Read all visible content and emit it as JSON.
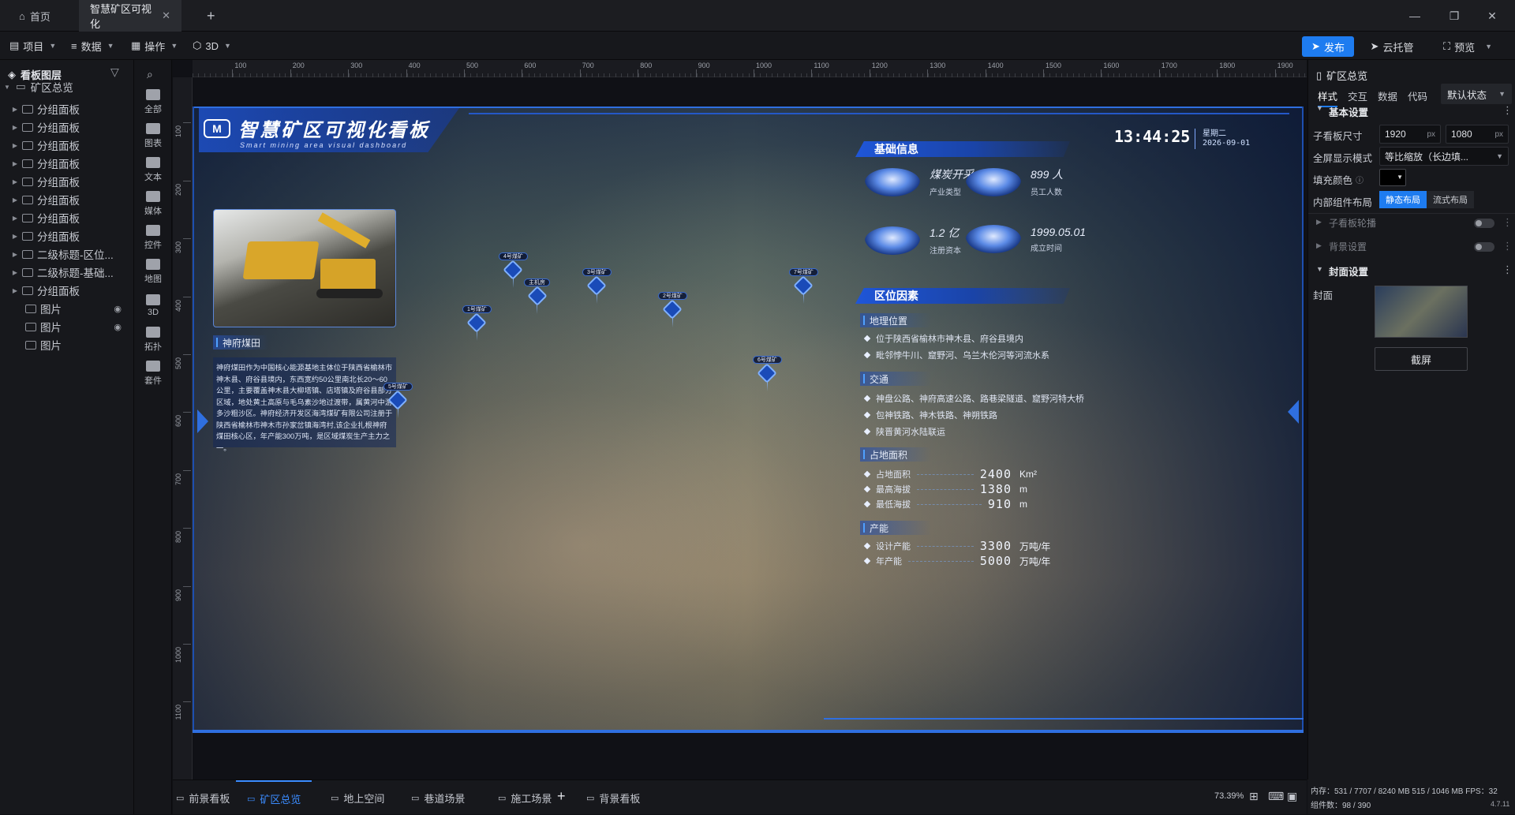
{
  "tabs": {
    "home": "首页",
    "doc": "智慧矿区可视化",
    "new": "+"
  },
  "window": {
    "minimize": "—",
    "restore": "❐",
    "close": "✕"
  },
  "menu": {
    "project": "项目",
    "data": "数据",
    "operate": "操作",
    "threed": "3D"
  },
  "actions": {
    "publish": "发布",
    "cloud": "云托管",
    "preview": "预览"
  },
  "layers": {
    "title": "看板图层",
    "root": "矿区总览",
    "items": [
      "分组面板",
      "分组面板",
      "分组面板",
      "分组面板",
      "分组面板",
      "分组面板",
      "分组面板",
      "分组面板",
      "二级标题-区位...",
      "二级标题-基础...",
      "分组面板",
      "图片",
      "图片",
      "图片"
    ]
  },
  "tools": [
    "全部",
    "图表",
    "文本",
    "媒体",
    "控件",
    "地图",
    "3D",
    "拓扑",
    "套件"
  ],
  "ruler": {
    "h": [
      "100",
      "200",
      "300",
      "400",
      "500",
      "600",
      "700",
      "800",
      "900",
      "1000",
      "1100",
      "1200",
      "1300",
      "1400",
      "1500",
      "1600",
      "1700",
      "1800",
      "1900"
    ],
    "v": [
      "100",
      "200",
      "300",
      "400",
      "500",
      "600",
      "700",
      "800",
      "900",
      "1000",
      "1100"
    ]
  },
  "dashboard": {
    "title": "智慧矿区可视化看板",
    "subtitle": "Smart mining area visual dashboard",
    "logo": "M",
    "time": "13:44:25",
    "weekday": "星期二",
    "date": "2026-09-01",
    "photo_caption": "神府煤田",
    "description": "神府煤田作为中国核心能源基地主体位于陕西省榆林市神木县、府谷县境内，东西宽约50公里南北长20～60公里，主要覆盖神木县大柳塔镇、店塔镇及府谷县部分区域，地处黄土高原与毛乌素沙地过渡带，属黄河中游多沙粗沙区。神府经济开发区海湾煤矿有限公司注册于陕西省榆林市神木市孙家岔镇海湾村,该企业扎根神府煤田核心区，年产能300万吨，是区域煤炭生产主力之一。",
    "basic_info_title": "基础信息",
    "basic_info": [
      {
        "value": "煤炭开采",
        "label": "产业类型"
      },
      {
        "value": "899 人",
        "label": "员工人数"
      },
      {
        "value": "1.2 亿",
        "label": "注册资本"
      },
      {
        "value": "1999.05.01",
        "label": "成立时间"
      }
    ],
    "location_title": "区位因素",
    "geo": {
      "title": "地理位置",
      "items": [
        "位于陕西省榆林市神木县、府谷县境内",
        "毗邻悖牛川、窟野河、乌兰木伦河等河流水系"
      ]
    },
    "traffic": {
      "title": "交通",
      "items": [
        "神盘公路、神府高速公路、路巷梁隧道、窟野河特大桥",
        "包神铁路、神木铁路、神朔铁路",
        "陕晋黄河水陆联运"
      ]
    },
    "area": {
      "title": "占地面积",
      "rows": [
        {
          "label": "占地面积",
          "value": "2400",
          "unit": "Km²"
        },
        {
          "label": "最高海拔",
          "value": "1380",
          "unit": "m"
        },
        {
          "label": "最低海拔",
          "value": "910",
          "unit": "m"
        }
      ]
    },
    "capacity": {
      "title": "产能",
      "rows": [
        {
          "label": "设计产能",
          "value": "3300",
          "unit": "万吨/年"
        },
        {
          "label": "年产能",
          "value": "5000",
          "unit": "万吨/年"
        }
      ]
    },
    "markers": [
      "4号煤矿",
      "1号煤矿",
      "主机房",
      "3号煤矿",
      "2号煤矿",
      "5号煤矿",
      "6号煤矿",
      "7号煤矿"
    ]
  },
  "props": {
    "header": "矿区总览",
    "tabs": [
      "样式",
      "交互",
      "数据",
      "代码"
    ],
    "state": "默认状态",
    "basic": "基本设置",
    "size_label": "子看板尺寸",
    "width": "1920",
    "height": "1080",
    "unit": "px",
    "fullscreen_label": "全屏显示模式",
    "fullscreen_value": "等比缩放（长边填...",
    "fill_label": "填充颜色",
    "layout_label": "内部组件布局",
    "layout_static": "静态布局",
    "layout_flow": "流式布局",
    "carousel": "子看板轮播",
    "background": "背景设置",
    "cover_section": "封面设置",
    "cover_label": "封面",
    "screenshot": "截屏"
  },
  "bottom_tabs": [
    "前景看板",
    "矿区总览",
    "地上空间",
    "巷道场景",
    "施工场景",
    "背景看板"
  ],
  "add_tab": "+",
  "zoom": "73.39%",
  "status": {
    "memory": "内存：531 / 7707 / 8240 MB  515 / 1046 MB FPS：32",
    "components": "组件数：98 / 390",
    "version": "4.7.11"
  },
  "colors": {
    "accent": "#1e7cf0",
    "panel": "#17181c",
    "dash_blue": "#1f56d8"
  }
}
